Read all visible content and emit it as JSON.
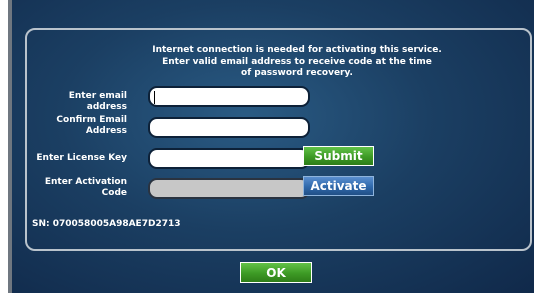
{
  "notice": {
    "line1": "Internet connection is needed for activating this service.",
    "line2": "Enter valid email address to receive code at the time",
    "line3": "of password recovery."
  },
  "form": {
    "email_label": "Enter email address",
    "email_value": "",
    "confirm_label_1": "Confirm Email",
    "confirm_label_2": "Address",
    "confirm_value": "",
    "license_label": "Enter License Key",
    "license_value": "",
    "activation_label_1": "Enter Activation",
    "activation_label_2": "Code",
    "activation_value": ""
  },
  "buttons": {
    "submit": "Submit",
    "activate": "Activate",
    "ok": "OK"
  },
  "serial": "SN: 070058005A98AE7D2713",
  "colors": {
    "background": "#1b3f63",
    "submit_green": "#3d9a25",
    "activate_blue": "#2f68ab",
    "disabled_field": "#c7c7c7"
  }
}
